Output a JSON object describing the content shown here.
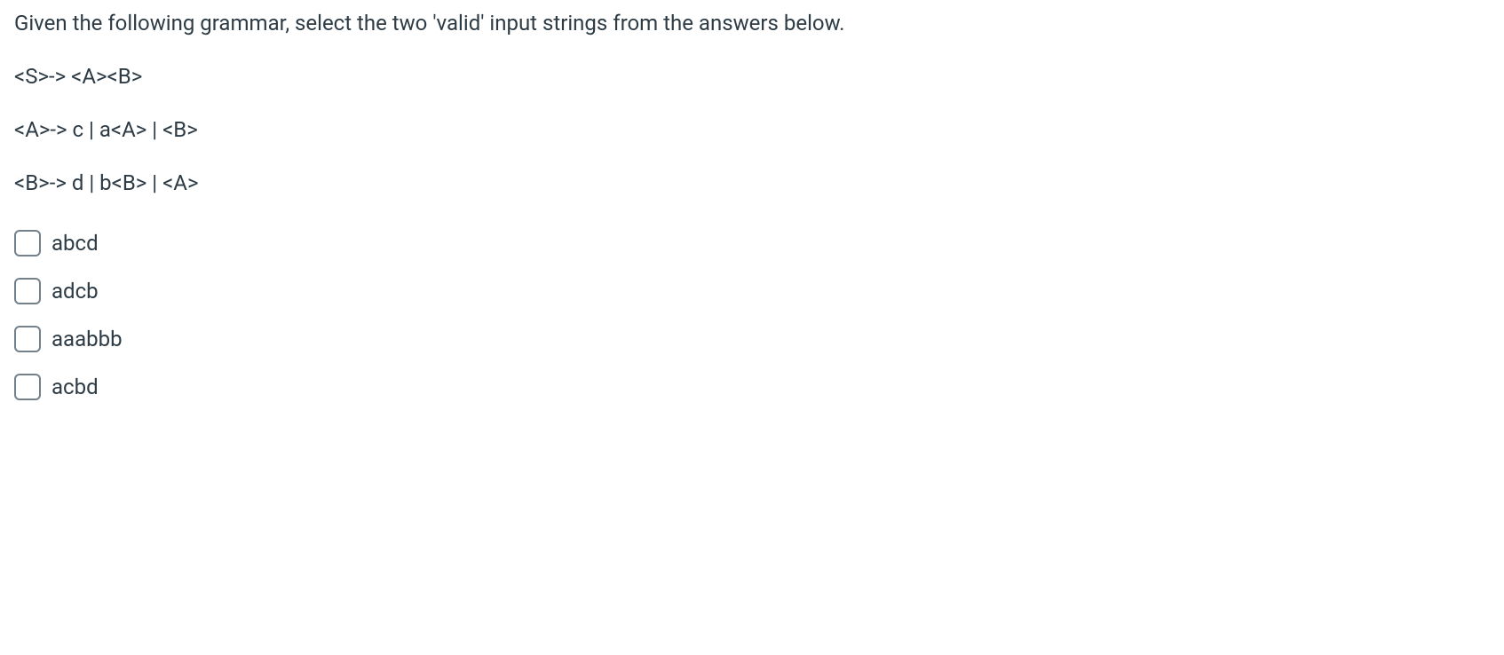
{
  "question": {
    "prompt": "Given the following grammar, select the two 'valid' input strings from the answers below.",
    "rules": [
      "<S>-> <A><B>",
      "<A>-> c | a<A> | <B>",
      "<B>-> d | b<B> | <A>"
    ]
  },
  "options": [
    {
      "label": "abcd"
    },
    {
      "label": "adcb"
    },
    {
      "label": "aaabbb"
    },
    {
      "label": "acbd"
    }
  ]
}
